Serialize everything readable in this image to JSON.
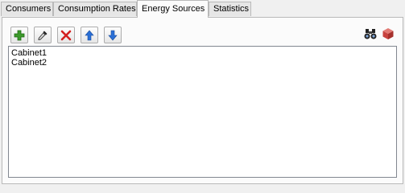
{
  "tabs": [
    {
      "label": "Consumers"
    },
    {
      "label": "Consumption Rates"
    },
    {
      "label": "Energy Sources",
      "active": true
    },
    {
      "label": "Statistics"
    }
  ],
  "toolbar": {
    "add": {
      "icon": "plus-icon",
      "color": "#3c9a2b"
    },
    "sample": {
      "icon": "eyedropper-icon",
      "color": "#222222"
    },
    "delete": {
      "icon": "red-x-icon",
      "color": "#d32020"
    },
    "move_up": {
      "icon": "arrow-up-icon",
      "color": "#2a6fd6"
    },
    "move_down": {
      "icon": "arrow-down-icon",
      "color": "#2a6fd6"
    },
    "find": {
      "icon": "binoculars-icon"
    },
    "object": {
      "icon": "red-cube-icon",
      "color": "#c8423f"
    }
  },
  "list": {
    "items": [
      "Cabinet1",
      "Cabinet2"
    ]
  }
}
